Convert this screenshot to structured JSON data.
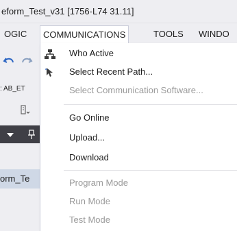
{
  "window": {
    "title": "eform_Test_v31 [1756-L74 31.11]"
  },
  "menu_bar": {
    "items": [
      {
        "label": "OGIC"
      },
      {
        "label": "COMMUNICATIONS"
      },
      {
        "label": "TOOLS"
      },
      {
        "label": "WINDO"
      }
    ]
  },
  "left_panel": {
    "path_label": ": AB_ET",
    "tab_label": "orm_Te"
  },
  "communications_menu": {
    "items": [
      {
        "label": "Who Active",
        "icon": "network-icon",
        "enabled": true
      },
      {
        "label": "Select Recent Path...",
        "icon": "path-icon",
        "enabled": true
      },
      {
        "label": "Select Communication Software...",
        "enabled": false
      },
      {
        "label": "Go Online",
        "enabled": true
      },
      {
        "label": "Upload...",
        "enabled": true
      },
      {
        "label": "Download",
        "enabled": true
      },
      {
        "label": "Program Mode",
        "enabled": false
      },
      {
        "label": "Run Mode",
        "enabled": false
      },
      {
        "label": "Test Mode",
        "enabled": false
      }
    ]
  },
  "colors": {
    "menu_bar_bg": "#eeeef2",
    "disabled_text": "#9a9a9a",
    "dark_toolbar": "#3f3f46",
    "tab_highlight": "#cfd8e6"
  }
}
